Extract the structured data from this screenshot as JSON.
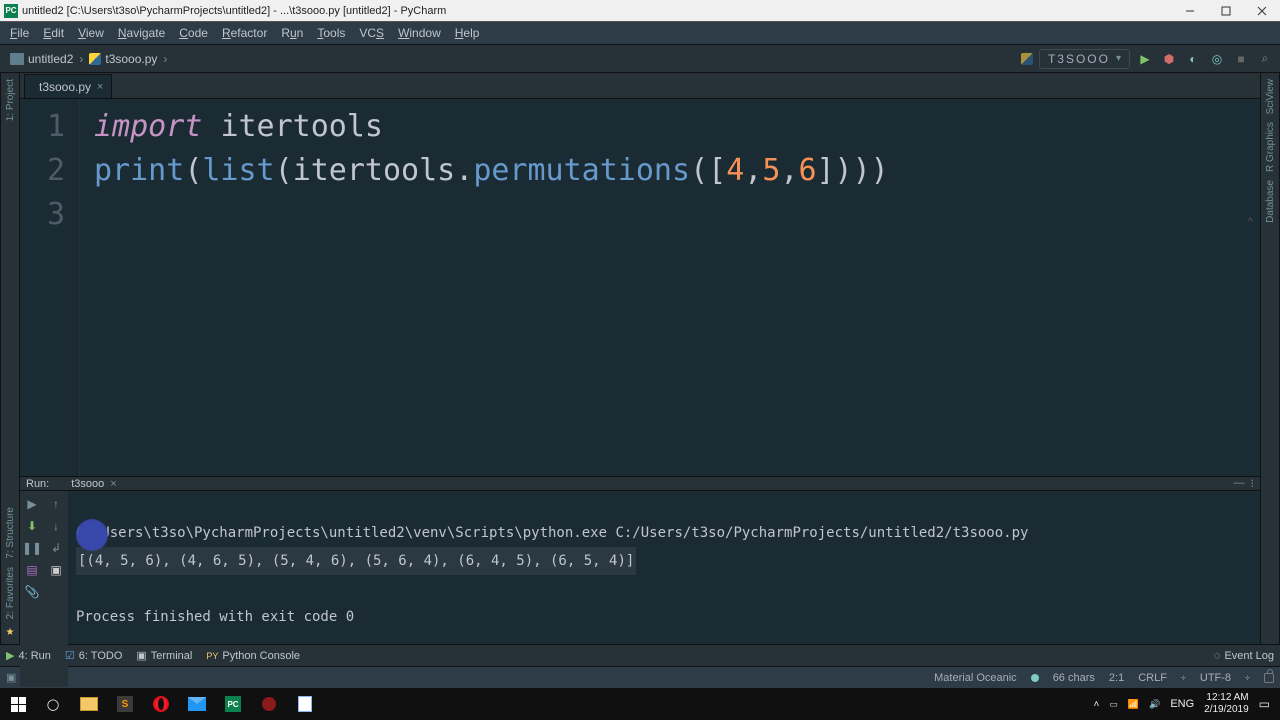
{
  "titlebar": {
    "text": "untitled2 [C:\\Users\\t3so\\PycharmProjects\\untitled2] - ...\\t3sooo.py [untitled2] - PyCharm"
  },
  "menu": {
    "file": "File",
    "edit": "Edit",
    "view": "View",
    "navigate": "Navigate",
    "code": "Code",
    "refactor": "Refactor",
    "run": "Run",
    "tools": "Tools",
    "vcs": "VCS",
    "window": "Window",
    "help": "Help"
  },
  "breadcrumb": {
    "project": "untitled2",
    "file": "t3sooo.py"
  },
  "run_config": {
    "name": "T3SOOO"
  },
  "tab": {
    "name": "t3sooo.py"
  },
  "code_lines": {
    "l1": {
      "num": "1"
    },
    "l2": {
      "num": "2"
    },
    "l3": {
      "num": "3"
    },
    "t_import": "import",
    "t_itertools": "itertools",
    "t_print": "print",
    "t_list": "list",
    "t_itertools2": "itertools",
    "t_perm": "permutations",
    "t_n4": "4",
    "t_n5": "5",
    "t_n6": "6"
  },
  "left_strip": {
    "project": "1: Project"
  },
  "right_strip": {
    "sciview": "SciView",
    "rgraphics": "R Graphics",
    "database": "Database"
  },
  "run": {
    "label": "Run:",
    "tab": "t3sooo",
    "cmd": "C:\\Users\\t3so\\PycharmProjects\\untitled2\\venv\\Scripts\\python.exe C:/Users/t3so/PycharmProjects/untitled2/t3sooo.py",
    "result": "[(4, 5, 6), (4, 6, 5), (5, 4, 6), (5, 6, 4), (6, 4, 5), (6, 5, 4)]",
    "exit": "Process finished with exit code 0"
  },
  "bottom": {
    "run": "4: Run",
    "todo": "6: TODO",
    "terminal": "Terminal",
    "pyconsole": "Python Console",
    "eventlog": "Event Log"
  },
  "left_strip2": {
    "structure": "7: Structure",
    "favorites": "2: Favorites"
  },
  "status": {
    "theme": "Material Oceanic",
    "chars": "66 chars",
    "pos": "2:1",
    "crlf": "CRLF",
    "enc": "UTF-8"
  },
  "tray": {
    "lang": "ENG",
    "time": "12:12 AM",
    "date": "2/19/2019"
  }
}
